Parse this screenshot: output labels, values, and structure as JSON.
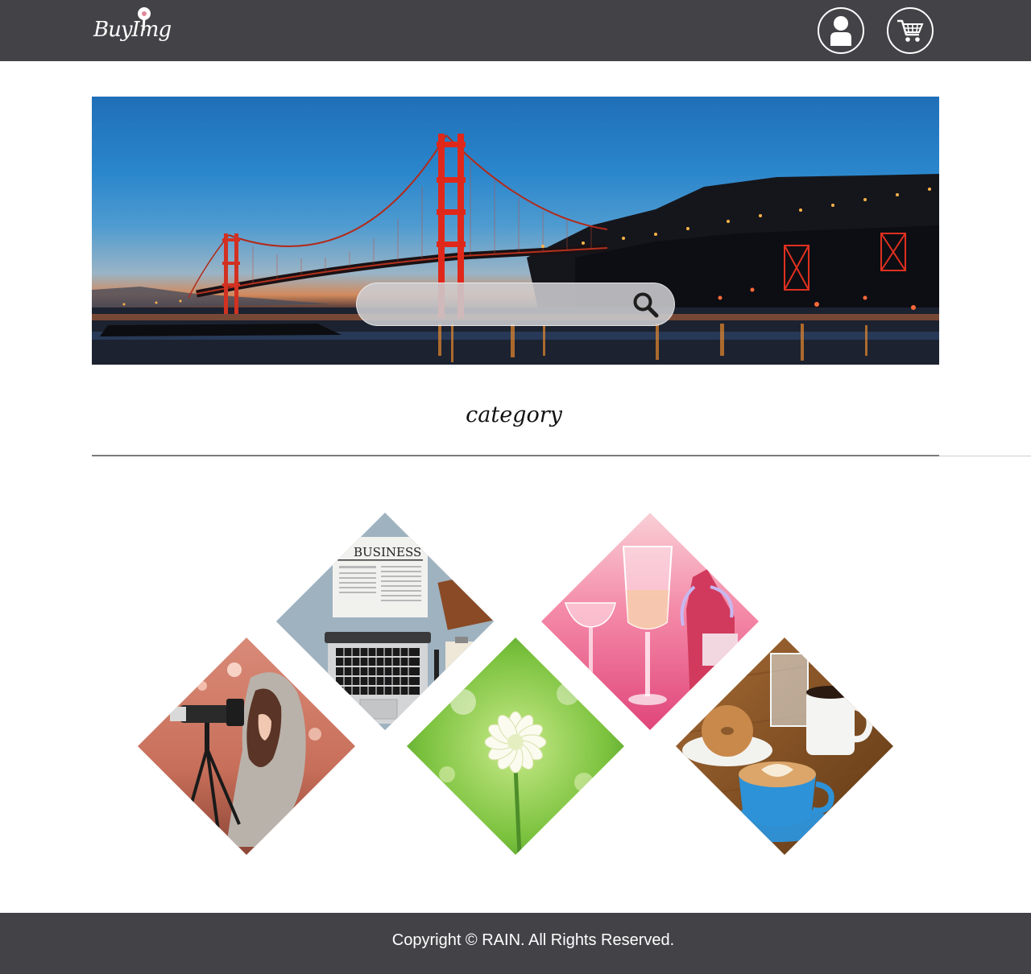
{
  "header": {
    "logo_text": "BuyImg",
    "user_icon": "user-icon",
    "cart_icon": "shopping-cart-icon"
  },
  "hero": {
    "image": "golden-gate-bridge-at-dusk",
    "search": {
      "value": "",
      "placeholder": "",
      "icon": "search-icon"
    }
  },
  "category": {
    "title": "category",
    "items": [
      {
        "name": "business",
        "image": "business-newspaper-laptop"
      },
      {
        "name": "celebration",
        "image": "pink-champagne-glasses"
      },
      {
        "name": "photography",
        "image": "woman-with-camera"
      },
      {
        "name": "nature",
        "image": "white-clover-flower"
      },
      {
        "name": "food",
        "image": "coffee-and-donut"
      }
    ]
  },
  "footer": {
    "copyright": "Copyright © RAIN. All Rights Reserved."
  }
}
